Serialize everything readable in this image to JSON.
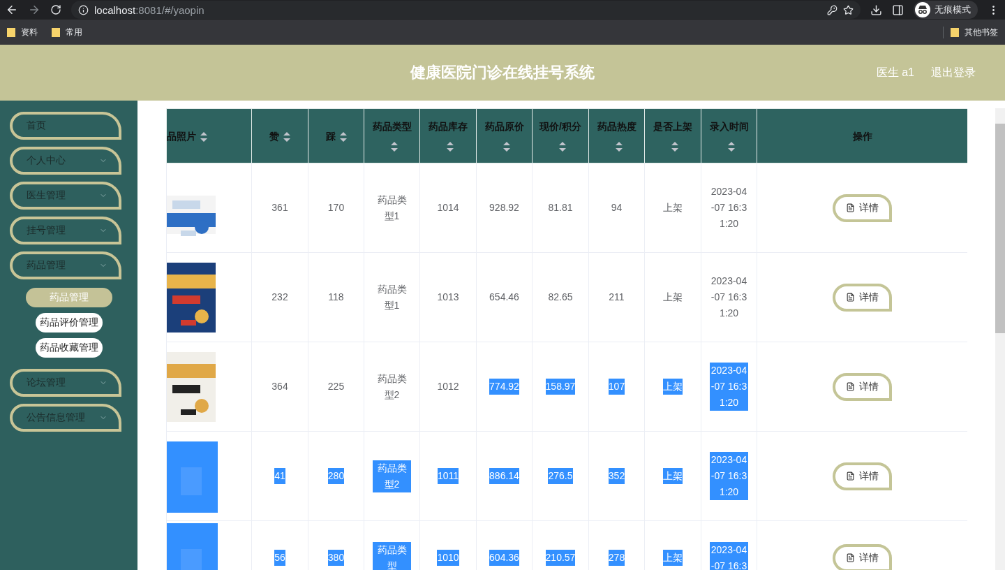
{
  "browser": {
    "url_host": "localhost",
    "url_path": ":8081/#/yaopin",
    "profile": "无痕模式",
    "bookmarks": [
      "资料",
      "常用"
    ],
    "other_bookmarks": "其他书签"
  },
  "header": {
    "title": "健康医院门诊在线挂号系统",
    "user": "医生 a1",
    "logout": "退出登录"
  },
  "sidebar": {
    "items": [
      {
        "label": "首页",
        "kind": "link"
      },
      {
        "label": "个人中心",
        "kind": "menu"
      },
      {
        "label": "医生管理",
        "kind": "menu"
      },
      {
        "label": "挂号管理",
        "kind": "menu"
      },
      {
        "label": "药品管理",
        "kind": "menu",
        "children": [
          {
            "label": "药品管理",
            "selected": true
          },
          {
            "label": "药品评价管理",
            "selected": false
          },
          {
            "label": "药品收藏管理",
            "selected": false
          }
        ]
      },
      {
        "label": "论坛管理",
        "kind": "menu"
      },
      {
        "label": "公告信息管理",
        "kind": "menu"
      }
    ]
  },
  "table": {
    "columns": [
      {
        "label": "品照片",
        "sortable": true
      },
      {
        "label": "赞",
        "sortable": true
      },
      {
        "label": "踩",
        "sortable": true
      },
      {
        "label": "药品类型",
        "sortable": true
      },
      {
        "label": "药品库存",
        "sortable": true
      },
      {
        "label": "药品原价",
        "sortable": true
      },
      {
        "label": "现价/积分",
        "sortable": true
      },
      {
        "label": "药品热度",
        "sortable": true
      },
      {
        "label": "是否上架",
        "sortable": true
      },
      {
        "label": "录入时间",
        "sortable": true
      },
      {
        "label": "操作",
        "sortable": false
      }
    ],
    "rows": [
      {
        "cells": [
          {
            "kind": "picture",
            "highlighted": false
          },
          {
            "kind": "text",
            "text": "361",
            "highlighted": false
          },
          {
            "kind": "text",
            "text": "170",
            "highlighted": false
          },
          {
            "kind": "text",
            "text": "药品类型1",
            "highlighted": false
          },
          {
            "kind": "text",
            "text": "1014",
            "highlighted": false
          },
          {
            "kind": "text",
            "text": "928.92",
            "highlighted": false
          },
          {
            "kind": "text",
            "text": "81.81",
            "highlighted": false
          },
          {
            "kind": "text",
            "text": "94",
            "highlighted": false
          },
          {
            "kind": "text",
            "text": "上架",
            "highlighted": false
          },
          {
            "kind": "text",
            "text": "2023-04-07 16:31:20",
            "highlighted": false
          },
          {
            "kind": "button",
            "text": "详情"
          }
        ]
      },
      {
        "cells": [
          {
            "kind": "picture",
            "highlighted": false
          },
          {
            "kind": "text",
            "text": "232",
            "highlighted": false
          },
          {
            "kind": "text",
            "text": "118",
            "highlighted": false
          },
          {
            "kind": "text",
            "text": "药品类型1",
            "highlighted": false
          },
          {
            "kind": "text",
            "text": "1013",
            "highlighted": false
          },
          {
            "kind": "text",
            "text": "654.46",
            "highlighted": false
          },
          {
            "kind": "text",
            "text": "82.65",
            "highlighted": false
          },
          {
            "kind": "text",
            "text": "211",
            "highlighted": false
          },
          {
            "kind": "text",
            "text": "上架",
            "highlighted": false
          },
          {
            "kind": "text",
            "text": "2023-04-07 16:31:20",
            "highlighted": false
          },
          {
            "kind": "button",
            "text": "详情"
          }
        ]
      },
      {
        "cells": [
          {
            "kind": "picture",
            "highlighted": false
          },
          {
            "kind": "text",
            "text": "364",
            "highlighted": false
          },
          {
            "kind": "text",
            "text": "225",
            "highlighted": false
          },
          {
            "kind": "text",
            "text": "药品类型2",
            "highlighted": false
          },
          {
            "kind": "text",
            "text": "1012",
            "highlighted": false
          },
          {
            "kind": "text",
            "text": "774.92",
            "highlighted": true
          },
          {
            "kind": "text",
            "text": "158.97",
            "highlighted": true
          },
          {
            "kind": "text",
            "text": "107",
            "highlighted": true
          },
          {
            "kind": "text",
            "text": "上架",
            "highlighted": true
          },
          {
            "kind": "text",
            "text": "2023-04-07 16:31:20",
            "highlighted": true
          },
          {
            "kind": "button",
            "text": "详情"
          }
        ]
      },
      {
        "cells": [
          {
            "kind": "picture",
            "highlighted": true
          },
          {
            "kind": "text",
            "text": "41",
            "highlighted": true
          },
          {
            "kind": "text",
            "text": "280",
            "highlighted": true
          },
          {
            "kind": "text",
            "text": "药品类型2",
            "highlighted": true
          },
          {
            "kind": "text",
            "text": "1011",
            "highlighted": true
          },
          {
            "kind": "text",
            "text": "886.14",
            "highlighted": true
          },
          {
            "kind": "text",
            "text": "276.5",
            "highlighted": true
          },
          {
            "kind": "text",
            "text": "352",
            "highlighted": true
          },
          {
            "kind": "text",
            "text": "上架",
            "highlighted": true
          },
          {
            "kind": "text",
            "text": "2023-04-07 16:31:20",
            "highlighted": true
          },
          {
            "kind": "button",
            "text": "详情"
          }
        ]
      },
      {
        "cells": [
          {
            "kind": "picture",
            "highlighted": true
          },
          {
            "kind": "text",
            "text": "56",
            "highlighted": true
          },
          {
            "kind": "text",
            "text": "380",
            "highlighted": true
          },
          {
            "kind": "text",
            "text": "药品类型",
            "highlighted": true
          },
          {
            "kind": "text",
            "text": "1010",
            "highlighted": true
          },
          {
            "kind": "text",
            "text": "604.36",
            "highlighted": true
          },
          {
            "kind": "text",
            "text": "210.57",
            "highlighted": true
          },
          {
            "kind": "text",
            "text": "278",
            "highlighted": true
          },
          {
            "kind": "text",
            "text": "上架",
            "highlighted": true
          },
          {
            "kind": "text",
            "text": "2023-04-07 16:3",
            "highlighted": true
          },
          {
            "kind": "button",
            "text": "详情"
          }
        ]
      }
    ]
  }
}
